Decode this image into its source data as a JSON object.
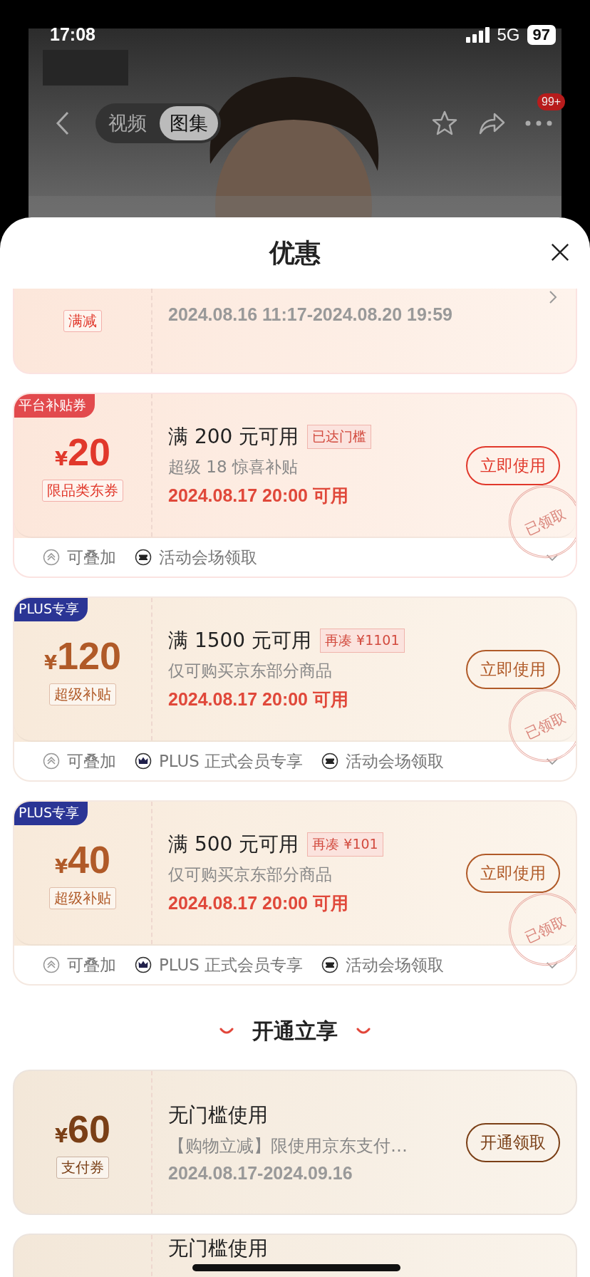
{
  "status_bar": {
    "time": "17:08",
    "network": "5G",
    "battery": "97"
  },
  "nav": {
    "tabs": [
      {
        "label": "视频",
        "selected": false
      },
      {
        "label": "图集",
        "selected": true
      }
    ],
    "badge": "99+"
  },
  "sheet": {
    "title": "优惠"
  },
  "coupons": [
    {
      "kind": "partial",
      "color": "#e1382b",
      "tag": "满减",
      "time": "2024.08.16 11:17-2024.08.20 19:59"
    },
    {
      "kind": "full",
      "color": "#e1382b",
      "badge": {
        "label": "平台补贴券",
        "color": "#e24a4d"
      },
      "currency": "¥",
      "amount": "20",
      "tag": "限品类东券",
      "condition": "满 200 元可用",
      "note": "已达门槛",
      "desc": "超级 18 惊喜补贴",
      "time": "2024.08.17 20:00 可用",
      "button": "立即使用",
      "stamp": "已领取",
      "features": [
        {
          "kind": "stack",
          "label": "可叠加"
        },
        {
          "kind": "venue",
          "label": "活动会场领取"
        }
      ]
    },
    {
      "kind": "full",
      "color": "#b05a28",
      "badge": {
        "label": "PLUS专享",
        "color": "#2b3595"
      },
      "currency": "¥",
      "amount": "120",
      "tag": "超级补贴",
      "condition": "满 1500 元可用",
      "note": "再凑 ¥1101",
      "desc": "仅可购买京东部分商品",
      "time": "2024.08.17 20:00 可用",
      "button": "立即使用",
      "stamp": "已领取",
      "features": [
        {
          "kind": "stack",
          "label": "可叠加"
        },
        {
          "kind": "crown",
          "label": "PLUS 正式会员专享"
        },
        {
          "kind": "venue",
          "label": "活动会场领取"
        }
      ]
    },
    {
      "kind": "full",
      "color": "#b05a28",
      "badge": {
        "label": "PLUS专享",
        "color": "#2b3595"
      },
      "currency": "¥",
      "amount": "40",
      "tag": "超级补贴",
      "condition": "满 500 元可用",
      "note": "再凑 ¥101",
      "desc": "仅可购买京东部分商品",
      "time": "2024.08.17 20:00 可用",
      "button": "立即使用",
      "stamp": "已领取",
      "features": [
        {
          "kind": "stack",
          "label": "可叠加"
        },
        {
          "kind": "crown",
          "label": "PLUS 正式会员专享"
        },
        {
          "kind": "venue",
          "label": "活动会场领取"
        }
      ]
    },
    {
      "kind": "heading",
      "label": "开通立享"
    },
    {
      "kind": "open",
      "color": "#7a3f16",
      "currency": "¥",
      "amount": "60",
      "tag": "支付券",
      "condition": "无门槛使用",
      "desc": "【购物立减】限使用京东支付…",
      "time": "2024.08.17-2024.09.16",
      "button": "开通领取"
    },
    {
      "kind": "cut",
      "condition": "无门槛使用"
    }
  ]
}
